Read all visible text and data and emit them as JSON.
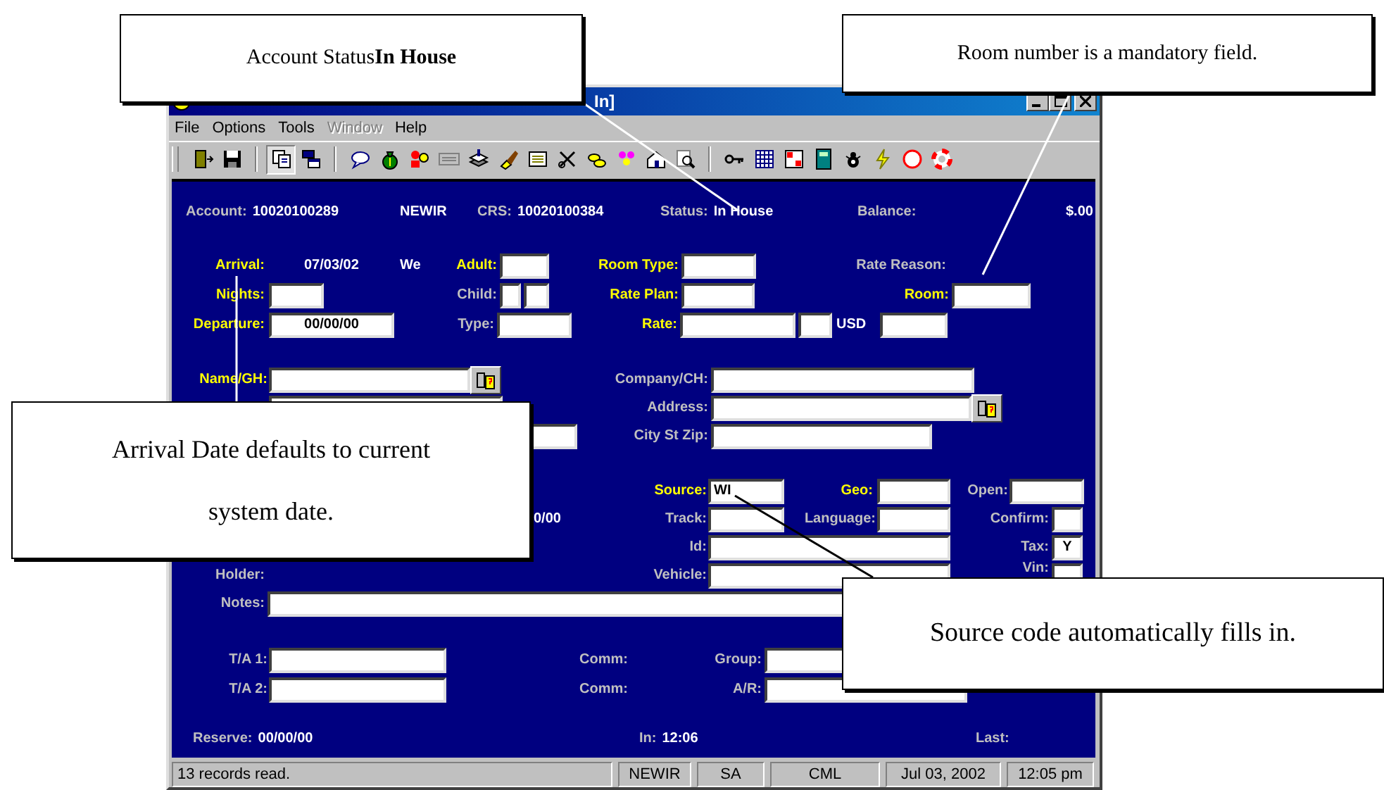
{
  "window": {
    "title": "In]",
    "menu": [
      {
        "label": "File",
        "disabled": false
      },
      {
        "label": "Options",
        "disabled": false
      },
      {
        "label": "Tools",
        "disabled": false
      },
      {
        "label": "Window",
        "disabled": true
      },
      {
        "label": "Help",
        "disabled": false
      }
    ]
  },
  "form": {
    "header": [
      {
        "label": "Account:",
        "value": "10020100289"
      },
      {
        "value": "NEWIR"
      },
      {
        "label": "CRS:",
        "value": "10020100384"
      },
      {
        "label": "Status:",
        "value": "In House"
      },
      {
        "label": "Balance:"
      },
      {
        "value": "$.00"
      }
    ],
    "items": [
      {
        "kind": "text",
        "label": "Arrival:",
        "mandatory": true,
        "value": "07/03/02"
      },
      {
        "kind": "text",
        "value": "We"
      },
      {
        "kind": "field",
        "label": "Adult:",
        "mandatory": true
      },
      {
        "kind": "field",
        "label": "Room Type:",
        "mandatory": true
      },
      {
        "kind": "text",
        "label": "Rate Reason:",
        "mandatory": false
      },
      {
        "kind": "field",
        "label": "Nights:",
        "mandatory": true
      },
      {
        "kind": "field",
        "label": "Child:",
        "mandatory": false
      },
      {
        "kind": "field",
        "label": "Rate Plan:",
        "mandatory": true
      },
      {
        "kind": "field",
        "label": "Room:",
        "mandatory": true
      },
      {
        "kind": "field",
        "label": "Departure:",
        "mandatory": true,
        "value": "00/00/00"
      },
      {
        "kind": "field",
        "label": "Type:",
        "mandatory": false
      },
      {
        "kind": "field",
        "label": "Rate:",
        "mandatory": true,
        "unit": "USD"
      },
      {
        "kind": "field",
        "label": "Name/GH:",
        "mandatory": true,
        "lookup": true
      },
      {
        "kind": "field",
        "label": "Company/CH:",
        "mandatory": false
      },
      {
        "kind": "field"
      },
      {
        "kind": "field",
        "label": "Address:",
        "mandatory": false,
        "lookup": true
      },
      {
        "kind": "field"
      },
      {
        "kind": "field",
        "label": "City St Zip:",
        "mandatory": false
      },
      {
        "kind": "field",
        "label": "Source:",
        "mandatory": true,
        "value": "WI"
      },
      {
        "kind": "field",
        "label": "Geo:",
        "mandatory": true
      },
      {
        "kind": "field",
        "label": "Open:",
        "mandatory": false
      },
      {
        "kind": "text",
        "value": "0/00"
      },
      {
        "kind": "field",
        "label": "Track:",
        "mandatory": false
      },
      {
        "kind": "field",
        "label": "Language:",
        "mandatory": false
      },
      {
        "kind": "field",
        "label": "Confirm:",
        "mandatory": false
      },
      {
        "kind": "field",
        "label": "Id:",
        "mandatory": false
      },
      {
        "kind": "field",
        "label": "Tax:",
        "mandatory": false,
        "value": "Y"
      },
      {
        "kind": "text",
        "label": "Holder:",
        "mandatory": false
      },
      {
        "kind": "field",
        "label": "Vehicle:",
        "mandatory": false
      },
      {
        "kind": "field",
        "label": "Vin:",
        "mandatory": false
      },
      {
        "kind": "field",
        "label": "Notes:",
        "mandatory": false
      },
      {
        "kind": "field",
        "label": "T/A 1:",
        "mandatory": false
      },
      {
        "kind": "text",
        "label": "Comm:",
        "mandatory": false
      },
      {
        "kind": "field",
        "label": "Group:",
        "mandatory": false
      },
      {
        "kind": "field",
        "label": "T/A 2:",
        "mandatory": false
      },
      {
        "kind": "text",
        "label": "Comm:",
        "mandatory": false
      },
      {
        "kind": "field",
        "label": "A/R:",
        "mandatory": false
      }
    ],
    "footer": [
      {
        "label": "Reserve:",
        "value": "00/00/00"
      },
      {
        "label": "In:",
        "value": "12:06"
      },
      {
        "label": "Last:"
      }
    ]
  },
  "status_bar": [
    "13 records read.",
    "NEWIR",
    "SA",
    "CML",
    "Jul 03, 2002",
    "12:05 pm"
  ],
  "callouts": [
    {
      "text": "Account Status**In House**"
    },
    {
      "text": "Room number is a mandatory field."
    },
    {
      "text": "Arrival Date defaults to current system date."
    },
    {
      "text": "Source code automatically fills in."
    }
  ]
}
